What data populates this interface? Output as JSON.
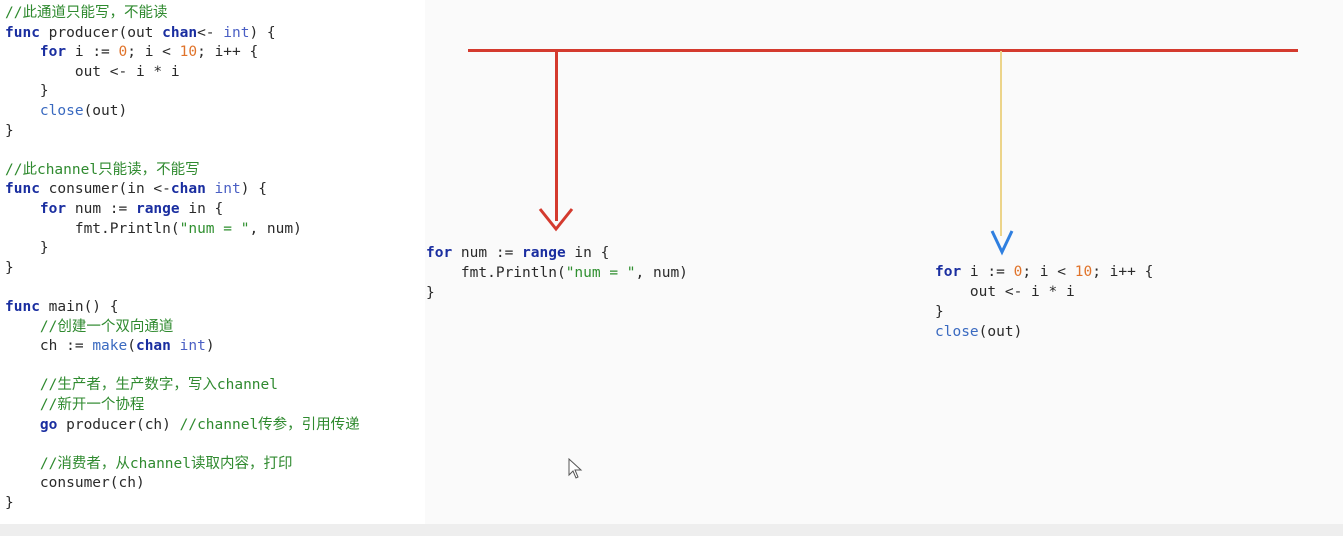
{
  "left_code": [
    {
      "parts": [
        {
          "t": "//此通道只能写，不能读",
          "c": "cm"
        }
      ]
    },
    {
      "parts": [
        {
          "t": "func",
          "c": "kw"
        },
        {
          "t": " producer(out ",
          "c": "fn"
        },
        {
          "t": "chan",
          "c": "kw"
        },
        {
          "t": "<- ",
          "c": "fn"
        },
        {
          "t": "int",
          "c": "ty"
        },
        {
          "t": ") {",
          "c": "fn"
        }
      ]
    },
    {
      "parts": [
        {
          "t": "    ",
          "c": "fn"
        },
        {
          "t": "for",
          "c": "kw"
        },
        {
          "t": " i := ",
          "c": "fn"
        },
        {
          "t": "0",
          "c": "num"
        },
        {
          "t": "; i < ",
          "c": "fn"
        },
        {
          "t": "10",
          "c": "num"
        },
        {
          "t": "; i++ {",
          "c": "fn"
        }
      ]
    },
    {
      "parts": [
        {
          "t": "        out <- i * i",
          "c": "fn"
        }
      ]
    },
    {
      "parts": [
        {
          "t": "    }",
          "c": "fn"
        }
      ]
    },
    {
      "parts": [
        {
          "t": "    ",
          "c": "fn"
        },
        {
          "t": "close",
          "c": "bi"
        },
        {
          "t": "(out)",
          "c": "fn"
        }
      ]
    },
    {
      "parts": [
        {
          "t": "}",
          "c": "fn"
        }
      ]
    },
    {
      "parts": [
        {
          "t": "",
          "c": "fn"
        }
      ]
    },
    {
      "parts": [
        {
          "t": "//此channel只能读，不能写",
          "c": "cm"
        }
      ]
    },
    {
      "parts": [
        {
          "t": "func",
          "c": "kw"
        },
        {
          "t": " consumer(in <-",
          "c": "fn"
        },
        {
          "t": "chan",
          "c": "kw"
        },
        {
          "t": " ",
          "c": "fn"
        },
        {
          "t": "int",
          "c": "ty"
        },
        {
          "t": ") {",
          "c": "fn"
        }
      ]
    },
    {
      "parts": [
        {
          "t": "    ",
          "c": "fn"
        },
        {
          "t": "for",
          "c": "kw"
        },
        {
          "t": " num := ",
          "c": "fn"
        },
        {
          "t": "range",
          "c": "kw"
        },
        {
          "t": " in {",
          "c": "fn"
        }
      ]
    },
    {
      "parts": [
        {
          "t": "        fmt.Println(",
          "c": "fn"
        },
        {
          "t": "\"num = \"",
          "c": "str"
        },
        {
          "t": ", num)",
          "c": "fn"
        }
      ]
    },
    {
      "parts": [
        {
          "t": "    }",
          "c": "fn"
        }
      ]
    },
    {
      "parts": [
        {
          "t": "}",
          "c": "fn"
        }
      ]
    },
    {
      "parts": [
        {
          "t": "",
          "c": "fn"
        }
      ]
    },
    {
      "parts": [
        {
          "t": "func",
          "c": "kw"
        },
        {
          "t": " main() {",
          "c": "fn"
        }
      ]
    },
    {
      "parts": [
        {
          "t": "    //创建一个双向通道",
          "c": "cm"
        }
      ]
    },
    {
      "parts": [
        {
          "t": "    ch := ",
          "c": "fn"
        },
        {
          "t": "make",
          "c": "bi"
        },
        {
          "t": "(",
          "c": "fn"
        },
        {
          "t": "chan",
          "c": "kw"
        },
        {
          "t": " ",
          "c": "fn"
        },
        {
          "t": "int",
          "c": "ty"
        },
        {
          "t": ")",
          "c": "fn"
        }
      ]
    },
    {
      "parts": [
        {
          "t": "",
          "c": "fn"
        }
      ]
    },
    {
      "parts": [
        {
          "t": "    //生产者，生产数字，写入channel",
          "c": "cm"
        }
      ]
    },
    {
      "parts": [
        {
          "t": "    //新开一个协程",
          "c": "cm"
        }
      ]
    },
    {
      "parts": [
        {
          "t": "    ",
          "c": "fn"
        },
        {
          "t": "go",
          "c": "kw"
        },
        {
          "t": " producer(ch) ",
          "c": "fn"
        },
        {
          "t": "//channel传参，引用传递",
          "c": "cm"
        }
      ]
    },
    {
      "parts": [
        {
          "t": "",
          "c": "fn"
        }
      ]
    },
    {
      "parts": [
        {
          "t": "    //消费者，从channel读取内容，打印",
          "c": "cm"
        }
      ]
    },
    {
      "parts": [
        {
          "t": "    consumer(ch)",
          "c": "fn"
        }
      ]
    },
    {
      "parts": [
        {
          "t": "}",
          "c": "fn"
        }
      ]
    }
  ],
  "consumer_snippet": [
    [
      {
        "t": "for",
        "c": "kw"
      },
      {
        "t": " num := ",
        "c": "fn"
      },
      {
        "t": "range",
        "c": "kw"
      },
      {
        "t": " in {",
        "c": "fn"
      }
    ],
    [
      {
        "t": "    fmt.Println(",
        "c": "fn"
      },
      {
        "t": "\"num = \"",
        "c": "str"
      },
      {
        "t": ", num)",
        "c": "fn"
      }
    ],
    [
      {
        "t": "}",
        "c": "fn"
      }
    ]
  ],
  "producer_snippet": [
    [
      {
        "t": "for",
        "c": "kw"
      },
      {
        "t": " i := ",
        "c": "fn"
      },
      {
        "t": "0",
        "c": "num"
      },
      {
        "t": "; i < ",
        "c": "fn"
      },
      {
        "t": "10",
        "c": "num"
      },
      {
        "t": "; i++ {",
        "c": "fn"
      }
    ],
    [
      {
        "t": "    out <- i * i",
        "c": "fn"
      }
    ],
    [
      {
        "t": "}",
        "c": "fn"
      }
    ],
    [
      {
        "t": "close",
        "c": "bi"
      },
      {
        "t": "(out)",
        "c": "fn"
      }
    ]
  ],
  "colors": {
    "red_arrow": "#d43a2e",
    "yellow_line": "#ecd48a",
    "blue_arrow": "#2f7fe0"
  }
}
